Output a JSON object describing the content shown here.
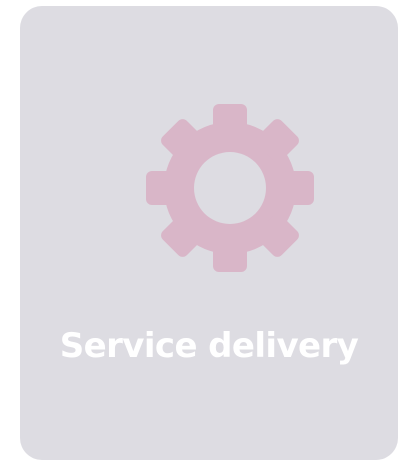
{
  "card": {
    "title": "Service delivery",
    "icon": "gear-icon",
    "background_color": "#dddce2",
    "icon_color": "#d9b6c8",
    "text_color": "#ffffff"
  }
}
